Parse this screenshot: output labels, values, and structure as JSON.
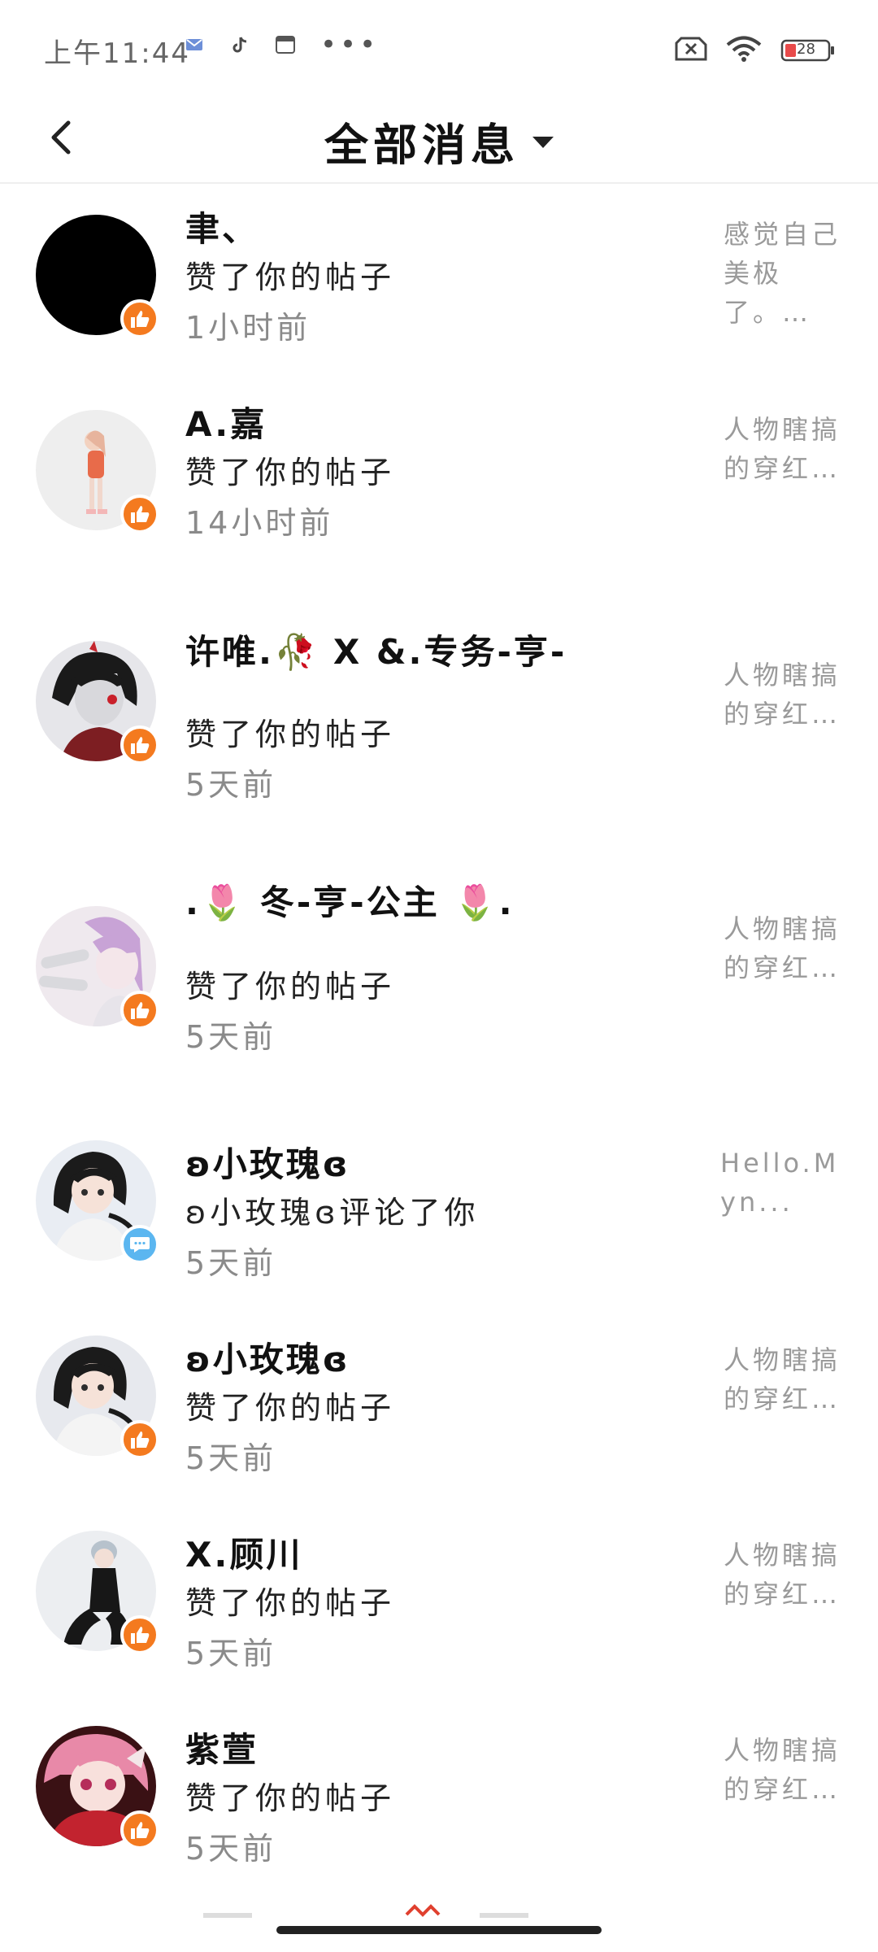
{
  "status": {
    "time": "上午11:44",
    "battery": "28"
  },
  "header": {
    "title": "全部消息"
  },
  "messages": [
    {
      "name": "聿、",
      "action": "赞了你的帖子",
      "time": "1小时前",
      "preview": "感觉自己美极了。…",
      "badge": "like-icon"
    },
    {
      "name": "A.嘉",
      "action": "赞了你的帖子",
      "time": "14小时前",
      "preview": "人物瞎搞的穿红…",
      "badge": "like-icon"
    },
    {
      "name": "许唯.🥀 X &.专务-亨-",
      "action": "赞了你的帖子",
      "time": "5天前",
      "preview": "人物瞎搞的穿红…",
      "badge": "like-icon"
    },
    {
      "name": ".🌷 冬-亨-公主 🌷.",
      "action": "赞了你的帖子",
      "time": "5天前",
      "preview": "人物瞎搞的穿红…",
      "badge": "like-icon"
    },
    {
      "name": "ʚ小玫瑰ɞ",
      "action": "ʚ小玫瑰ɞ评论了你",
      "time": "5天前",
      "preview": "Hello.Myn...",
      "badge": "comment-icon"
    },
    {
      "name": "ʚ小玫瑰ɞ",
      "action": "赞了你的帖子",
      "time": "5天前",
      "preview": "人物瞎搞的穿红…",
      "badge": "like-icon"
    },
    {
      "name": "X.顾川",
      "action": "赞了你的帖子",
      "time": "5天前",
      "preview": "人物瞎搞的穿红…",
      "badge": "like-icon"
    },
    {
      "name": "紫萱",
      "action": "赞了你的帖子",
      "time": "5天前",
      "preview": "人物瞎搞的穿红…",
      "badge": "like-icon"
    }
  ],
  "colors": {
    "like_badge": "#f47a1f",
    "comment_badge": "#5bb6f0"
  }
}
